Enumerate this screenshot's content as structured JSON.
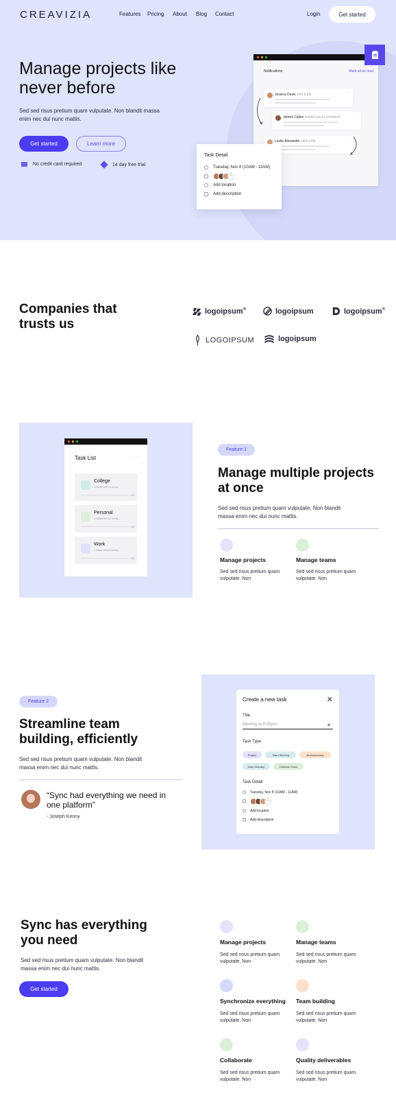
{
  "nav": {
    "logo": "CREAVIZIA",
    "links": [
      "Features",
      "Pricing",
      "About",
      "Blog",
      "Contact"
    ],
    "login": "Login",
    "cta": "Get started"
  },
  "hero": {
    "title": "Manage projects like never before",
    "subtitle": "Sed sed risus pretium quam vulputate. Non blandit massa enim nec dui nunc mattis.",
    "primary_cta": "Get started",
    "secondary_cta": "Learn more",
    "feature_1": "No credit card required",
    "feature_2": "14 day free trial",
    "notifications": {
      "header": "Notifications",
      "mark_all": "Mark all as read",
      "items": [
        {
          "name": "Jessica Davis",
          "action": "sent a file"
        },
        {
          "name": "James Callen",
          "action": "invited you to comment"
        },
        {
          "name": "Leslie Alexander",
          "action": "sent a file"
        }
      ]
    },
    "task_detail": {
      "title": "Task Detail",
      "date": "Tuesday, Nov 8 (10AM - 11AM)",
      "location": "Add location",
      "description": "Add description"
    }
  },
  "trust": {
    "title": "Companies that trusts us",
    "logos": [
      "logoipsum",
      "logoipsum",
      "logoipsum",
      "LOGOIPSUM",
      "logoipsum"
    ]
  },
  "feature1": {
    "pill": "Feature 1",
    "title": "Manage multiple projects at once",
    "subtitle": "Sed sed risus pretium quam vulputate. Non blandit massa enim nec dui nunc mattis.",
    "items": [
      {
        "title": "Manage projects",
        "desc": "Sed sed risus pretium quam vulputate. Non"
      },
      {
        "title": "Manage teams",
        "desc": "Sed sed risus pretium quam vulputate. Non"
      }
    ],
    "tasklist": {
      "title": "Task List",
      "cards": [
        {
          "name": "College",
          "meta": "2 tasks left for today",
          "count": "0/4"
        },
        {
          "name": "Personal",
          "meta": "2 tasks left for today",
          "count": "0/4"
        },
        {
          "name": "Work",
          "meta": "2 tasks left for today",
          "count": "0/4"
        }
      ]
    }
  },
  "feature2": {
    "pill": "Feature 2",
    "title": "Streamline team building, efficiently",
    "subtitle": "Sed sed risus pretium quam vulputate. Non blandit massa enim nec dui nunc mattis.",
    "quote": "“Sync had everything we need in one platform”",
    "quote_author": "- Joseph Kenny",
    "create_task": {
      "title": "Create a new task",
      "title_label": "Title",
      "title_placeholder": "Meeting at 6:00pm",
      "type_label": "Task Type",
      "tags": [
        "Project",
        "Team Meeting",
        "Brainstorming",
        "Daily Standup",
        "Dribbble Shots"
      ],
      "detail_label": "Task Detail",
      "date": "Tuesday, Nov 8 (10AM - 11AM)",
      "location": "Add location",
      "description": "Add description"
    }
  },
  "sync": {
    "title": "Sync has everything you need",
    "subtitle": "Sed sed risus pretium quam vulputate. Non blandit massa enim nec dui nunc mattis.",
    "cta": "Get started",
    "items": [
      {
        "title": "Manage projects",
        "desc": "Sed sed risus pretium quam vulputate. Non",
        "color": "#e7e2fb"
      },
      {
        "title": "Manage teams",
        "desc": "Sed sed risus pretium quam vulputate. Non",
        "color": "#dcefd9"
      },
      {
        "title": "Synchronize everything",
        "desc": "Sed sed risus pretium quam vulputate. Non",
        "color": "#d4dafb"
      },
      {
        "title": "Team building",
        "desc": "Sed sed risus pretium quam vulputate. Non",
        "color": "#fbe1cc"
      },
      {
        "title": "Collaborate",
        "desc": "Sed sed risus pretium quam vulputate. Non",
        "color": "#dcefd9"
      },
      {
        "title": "Quality deliverables",
        "desc": "Sed sed risus pretium quam vulputate. Non",
        "color": "#e7e2fb"
      }
    ]
  },
  "colors": {
    "primary": "#4b3cf0",
    "hero_bg": "#dfe3fb",
    "accent": "#5a48ee"
  }
}
